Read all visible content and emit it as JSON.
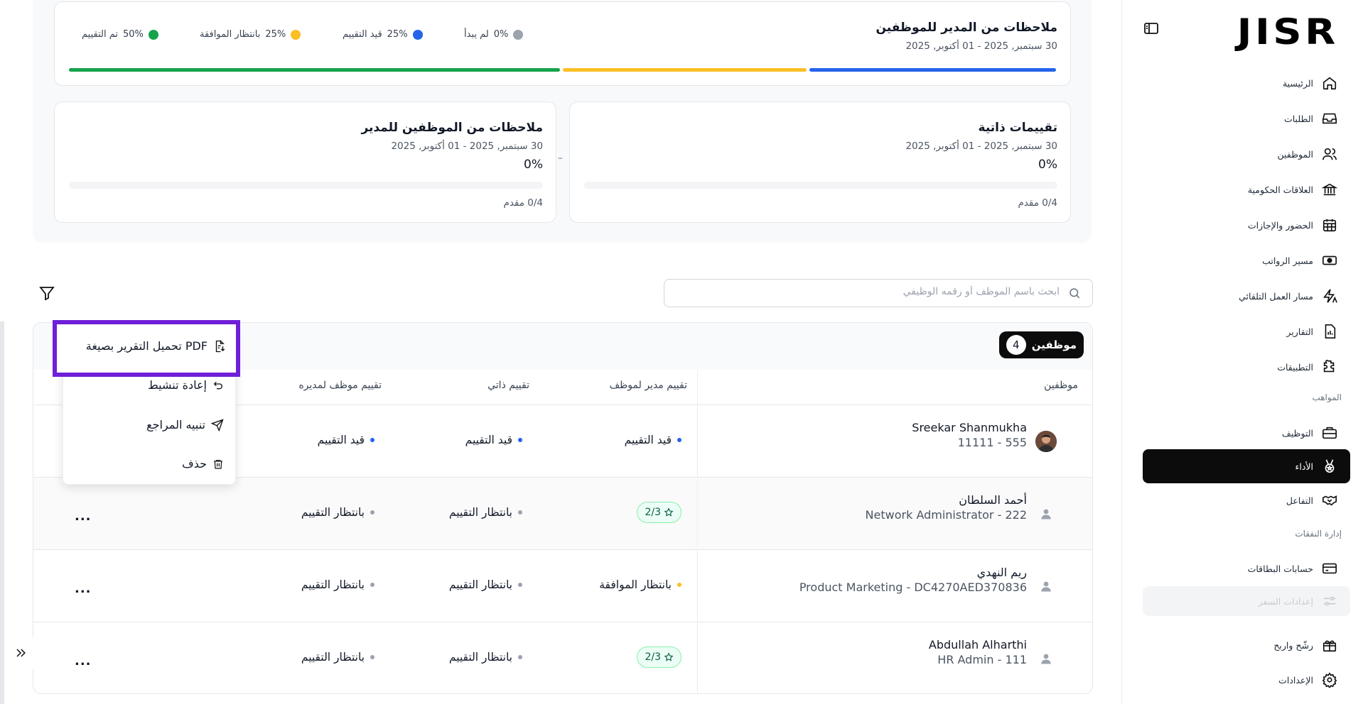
{
  "sidebar": {
    "logo": "JISR",
    "items": [
      {
        "label": "الرئيسية",
        "icon": "home-icon"
      },
      {
        "label": "الطلبات",
        "icon": "inbox-icon"
      },
      {
        "label": "الموظفين",
        "icon": "users-icon"
      },
      {
        "label": "العلاقات الحكومية",
        "icon": "government-building-icon"
      },
      {
        "label": "الحضور والإجازات",
        "icon": "calendar-icon"
      },
      {
        "label": "مسير الرواتب",
        "icon": "payroll-cash-icon"
      },
      {
        "label": "مسار العمل التلقائي",
        "icon": "automation-icon"
      },
      {
        "label": "التقارير",
        "icon": "report-icon"
      },
      {
        "label": "التطبيقات",
        "icon": "puzzle-icon"
      }
    ],
    "section_talent": "المواهب",
    "talent_items": [
      {
        "label": "التوظيف",
        "icon": "briefcase-icon"
      },
      {
        "label": "الأداء",
        "icon": "medal-icon"
      },
      {
        "label": "التفاعل",
        "icon": "handshake-icon"
      }
    ],
    "section_expenses": "إدارة النفقات",
    "expense_items": [
      {
        "label": "حسابات البطاقات",
        "icon": "credit-card-icon"
      },
      {
        "label": "إعدادات السفر",
        "icon": "sliders-icon"
      }
    ],
    "bottom_items": [
      {
        "label": "رشّح واربح",
        "icon": "gift-icon"
      },
      {
        "label": "الإعدادات",
        "icon": "gear-icon"
      }
    ]
  },
  "overview": {
    "main_card": {
      "title": "ملاحظات من المدير للموظفين",
      "date": "30 سبتمبر, 2025 - 01 أكتوبر, 2025",
      "legend": [
        {
          "label": "لم يبدأ",
          "percent": "0%",
          "color": "#9ca3af"
        },
        {
          "label": "قيد التقييم",
          "percent": "25%",
          "color": "#2563eb"
        },
        {
          "label": "بانتظار الموافقة",
          "percent": "25%",
          "color": "#fbbf24"
        },
        {
          "label": "تم التقييم",
          "percent": "50%",
          "color": "#16a34a"
        }
      ],
      "progress": [
        {
          "name": "completed",
          "fraction": 0.5,
          "color": "#16a34a"
        },
        {
          "name": "pending-approval",
          "fraction": 0.25,
          "color": "#fbbf24"
        },
        {
          "name": "in-review",
          "fraction": 0.25,
          "color": "#2563eb"
        }
      ]
    },
    "self_card": {
      "title": "تقييمات ذاتية",
      "date": "30 سبتمبر, 2025 - 01 أكتوبر, 2025",
      "percent": "0%",
      "submitted": "0/4 مقدم"
    },
    "emp_to_mgr_card": {
      "title": "ملاحظات من الموظفين للمدير",
      "date": "30 سبتمبر, 2025 - 01 أكتوبر, 2025",
      "percent": "0%",
      "submitted": "0/4 مقدم"
    },
    "separator": "–"
  },
  "search": {
    "placeholder": "ابحث باسم الموظف أو رقمه الوظيفي"
  },
  "table": {
    "badge_label": "موظفين",
    "badge_count": "4",
    "columns": {
      "employees": "موظفين",
      "mgr_to_emp": "تقييم مدير لموظف",
      "self": "تقييم ذاتي",
      "emp_to_mgr": "تقييم موظف لمديره"
    },
    "rows": [
      {
        "name": "Sreekar Shanmukha",
        "sub": "11111 - 555",
        "avatar": "photo",
        "mgr": {
          "type": "status",
          "label": "قيد التقييم",
          "color": "#2563eb"
        },
        "self": {
          "label": "قيد التقييم",
          "color": "#2563eb"
        },
        "emp": {
          "label": "قيد التقييم",
          "color": "#2563eb"
        }
      },
      {
        "name": "أحمد السلطان",
        "sub": "Network Administrator - 222",
        "avatar": "person",
        "mgr": {
          "type": "pill",
          "label": "2/3"
        },
        "self": {
          "label": "بانتظار التقييم",
          "color": "#9ca3af"
        },
        "emp": {
          "label": "بانتظار التقييم",
          "color": "#9ca3af"
        },
        "more": "..."
      },
      {
        "name": "ريم النهدي",
        "sub": "Product Marketing - DC4270AED370836",
        "avatar": "person",
        "mgr": {
          "type": "status",
          "label": "بانتظار الموافقة",
          "color": "#fbbf24"
        },
        "self": {
          "label": "بانتظار التقييم",
          "color": "#9ca3af"
        },
        "emp": {
          "label": "بانتظار التقييم",
          "color": "#9ca3af"
        },
        "more": "..."
      },
      {
        "name": "Abdullah Alharthi",
        "sub": "HR Admin - 111",
        "avatar": "person",
        "mgr": {
          "type": "pill",
          "label": "2/3"
        },
        "self": {
          "label": "بانتظار التقييم",
          "color": "#9ca3af"
        },
        "emp": {
          "label": "بانتظار التقييم",
          "color": "#9ca3af"
        },
        "more": "..."
      }
    ]
  },
  "dropdown": {
    "download_pdf": "تحميل التقرير بصيغة PDF",
    "reactivate": "إعادة تنشيط",
    "remind_reviewer": "تنبيه المراجع",
    "delete": "حذف"
  }
}
